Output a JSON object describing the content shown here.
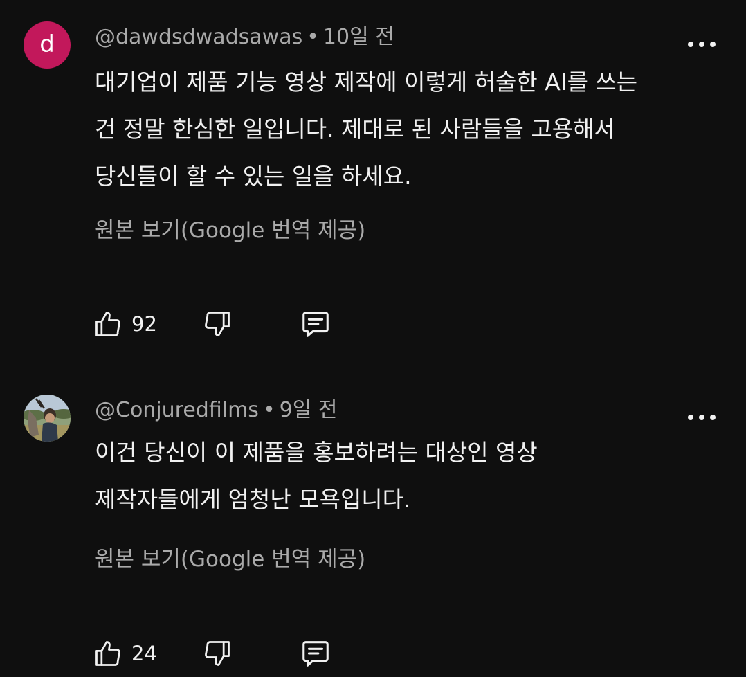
{
  "comments": [
    {
      "avatar_letter": "d",
      "avatar_color": "#c2185b",
      "author": "@dawdsdwadsawas",
      "separator": "•",
      "time": "10일 전",
      "text": "대기업이 제품 기능 영상 제작에 이렇게 허술한 AI를 쓰는\n건 정말 한심한 일입니다. 제대로 된 사람들을 고용해서\n당신들이 할 수 있는 일을 하세요.",
      "translate_label": "원본 보기(Google 번역 제공)",
      "like_count": "92",
      "icons": {
        "like": "thumbs-up-icon",
        "dislike": "thumbs-down-icon",
        "reply": "comment-reply-icon",
        "more": "more-vert-icon"
      }
    },
    {
      "avatar_letter": "",
      "avatar_color": "#6b7c5a",
      "author": "@Conjuredfilms",
      "separator": "•",
      "time": "9일 전",
      "text": "이건 당신이 이 제품을 홍보하려는 대상인 영상\n제작자들에게 엄청난 모욕입니다.",
      "translate_label": "원본 보기(Google 번역 제공)",
      "like_count": "24",
      "icons": {
        "like": "thumbs-up-icon",
        "dislike": "thumbs-down-icon",
        "reply": "comment-reply-icon",
        "more": "more-vert-icon"
      }
    }
  ],
  "colors": {
    "background": "#0f0f0f",
    "primary_text": "#f1f1f1",
    "secondary_text": "#aaaaaa"
  }
}
